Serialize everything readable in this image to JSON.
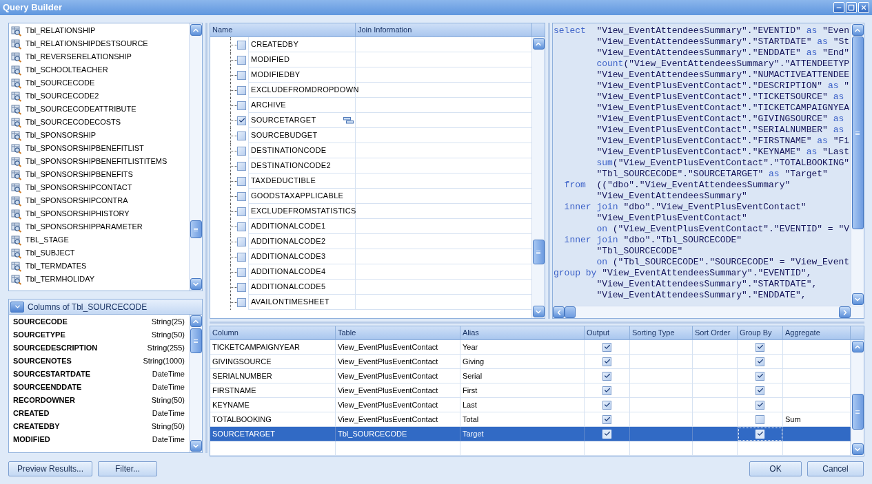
{
  "window": {
    "title": "Query Builder"
  },
  "tables": {
    "items": [
      "Tbl_RELATIONSHIP",
      "Tbl_RELATIONSHIPDESTSOURCE",
      "Tbl_REVERSERELATIONSHIP",
      "Tbl_SCHOOLTEACHER",
      "Tbl_SOURCECODE",
      "Tbl_SOURCECODE2",
      "Tbl_SOURCECODEATTRIBUTE",
      "Tbl_SOURCECODECOSTS",
      "Tbl_SPONSORSHIP",
      "Tbl_SPONSORSHIPBENEFITLIST",
      "Tbl_SPONSORSHIPBENEFITLISTITEMS",
      "Tbl_SPONSORSHIPBENEFITS",
      "Tbl_SPONSORSHIPCONTACT",
      "Tbl_SPONSORSHIPCONTRA",
      "Tbl_SPONSORSHIPHISTORY",
      "Tbl_SPONSORSHIPPARAMETER",
      "TBL_STAGE",
      "Tbl_SUBJECT",
      "Tbl_TERMDATES",
      "Tbl_TERMHOLIDAY"
    ]
  },
  "columns_panel": {
    "title": "Columns of Tbl_SOURCECODE",
    "columns": [
      {
        "name": "SOURCECODE",
        "type": "String(25)"
      },
      {
        "name": "SOURCETYPE",
        "type": "String(50)"
      },
      {
        "name": "SOURCEDESCRIPTION",
        "type": "String(255)"
      },
      {
        "name": "SOURCENOTES",
        "type": "String(1000)"
      },
      {
        "name": "SOURCESTARTDATE",
        "type": "DateTime"
      },
      {
        "name": "SOURCEENDDATE",
        "type": "DateTime"
      },
      {
        "name": "RECORDOWNER",
        "type": "String(50)"
      },
      {
        "name": "CREATED",
        "type": "DateTime"
      },
      {
        "name": "CREATEDBY",
        "type": "String(50)"
      },
      {
        "name": "MODIFIED",
        "type": "DateTime"
      }
    ]
  },
  "tree": {
    "columns": [
      "Name",
      "Join Information"
    ],
    "rows": [
      {
        "name": "CREATEDBY",
        "checked": false
      },
      {
        "name": "MODIFIED",
        "checked": false
      },
      {
        "name": "MODIFIEDBY",
        "checked": false
      },
      {
        "name": "EXCLUDEFROMDROPDOWN",
        "checked": false
      },
      {
        "name": "ARCHIVE",
        "checked": false
      },
      {
        "name": "SOURCETARGET",
        "checked": true
      },
      {
        "name": "SOURCEBUDGET",
        "checked": false
      },
      {
        "name": "DESTINATIONCODE",
        "checked": false
      },
      {
        "name": "DESTINATIONCODE2",
        "checked": false
      },
      {
        "name": "TAXDEDUCTIBLE",
        "checked": false
      },
      {
        "name": "GOODSTAXAPPLICABLE",
        "checked": false
      },
      {
        "name": "EXCLUDEFROMSTATISTICS",
        "checked": false
      },
      {
        "name": "ADDITIONALCODE1",
        "checked": false
      },
      {
        "name": "ADDITIONALCODE2",
        "checked": false
      },
      {
        "name": "ADDITIONALCODE3",
        "checked": false
      },
      {
        "name": "ADDITIONALCODE4",
        "checked": false
      },
      {
        "name": "ADDITIONALCODE5",
        "checked": false
      },
      {
        "name": "AVAILONTIMESHEET",
        "checked": false
      }
    ]
  },
  "sql": {
    "lines": [
      {
        "tokens": [
          {
            "kind": "keyword",
            "text": "select"
          },
          {
            "kind": "text",
            "text": "  \"View_EventAttendeesSummary\".\"EVENTID\" "
          },
          {
            "kind": "keyword",
            "text": "as"
          },
          {
            "kind": "text",
            "text": " \"Even"
          }
        ]
      },
      {
        "tokens": [
          {
            "kind": "text",
            "text": "        \"View_EventAttendeesSummary\".\"STARTDATE\" "
          },
          {
            "kind": "keyword",
            "text": "as"
          },
          {
            "kind": "text",
            "text": " \"St"
          }
        ]
      },
      {
        "tokens": [
          {
            "kind": "text",
            "text": "        \"View_EventAttendeesSummary\".\"ENDDATE\" "
          },
          {
            "kind": "keyword",
            "text": "as"
          },
          {
            "kind": "text",
            "text": " \"End\""
          }
        ]
      },
      {
        "tokens": [
          {
            "kind": "keyword",
            "text": "        count"
          },
          {
            "kind": "text",
            "text": "(\"View_EventAttendeesSummary\".\"ATTENDEETYP"
          }
        ]
      },
      {
        "tokens": [
          {
            "kind": "text",
            "text": "        \"View_EventAttendeesSummary\".\"NUMACTIVEATTENDEE"
          }
        ]
      },
      {
        "tokens": [
          {
            "kind": "text",
            "text": "        \"View_EventPlusEventContact\".\"DESCRIPTION\" "
          },
          {
            "kind": "keyword",
            "text": "as"
          },
          {
            "kind": "text",
            "text": " \""
          }
        ]
      },
      {
        "tokens": [
          {
            "kind": "text",
            "text": "        \"View_EventPlusEventContact\".\"TICKETSOURCE\" "
          },
          {
            "kind": "keyword",
            "text": "as"
          }
        ]
      },
      {
        "tokens": [
          {
            "kind": "text",
            "text": "        \"View_EventPlusEventContact\".\"TICKETCAMPAIGNYEA"
          }
        ]
      },
      {
        "tokens": [
          {
            "kind": "text",
            "text": "        \"View_EventPlusEventContact\".\"GIVINGSOURCE\" "
          },
          {
            "kind": "keyword",
            "text": "as"
          }
        ]
      },
      {
        "tokens": [
          {
            "kind": "text",
            "text": "        \"View_EventPlusEventContact\".\"SERIALNUMBER\" "
          },
          {
            "kind": "keyword",
            "text": "as"
          }
        ]
      },
      {
        "tokens": [
          {
            "kind": "text",
            "text": "        \"View_EventPlusEventContact\".\"FIRSTNAME\" "
          },
          {
            "kind": "keyword",
            "text": "as"
          },
          {
            "kind": "text",
            "text": " \"Fi"
          }
        ]
      },
      {
        "tokens": [
          {
            "kind": "text",
            "text": "        \"View_EventPlusEventContact\".\"KEYNAME\" "
          },
          {
            "kind": "keyword",
            "text": "as"
          },
          {
            "kind": "text",
            "text": " \"Last"
          }
        ]
      },
      {
        "tokens": [
          {
            "kind": "keyword",
            "text": "        sum"
          },
          {
            "kind": "text",
            "text": "(\"View_EventPlusEventContact\".\"TOTALBOOKING\""
          }
        ]
      },
      {
        "tokens": [
          {
            "kind": "text",
            "text": "        \"Tbl_SOURCECODE\".\"SOURCETARGET\" "
          },
          {
            "kind": "keyword",
            "text": "as"
          },
          {
            "kind": "text",
            "text": " \"Target\""
          }
        ]
      },
      {
        "tokens": [
          {
            "kind": "keyword",
            "text": "  from"
          },
          {
            "kind": "text",
            "text": "  ((\"dbo\".\"View_EventAttendeesSummary\""
          }
        ]
      },
      {
        "tokens": [
          {
            "kind": "text",
            "text": "        \"View_EventAttendeesSummary\""
          }
        ]
      },
      {
        "tokens": [
          {
            "kind": "keyword",
            "text": "  inner join"
          },
          {
            "kind": "text",
            "text": " \"dbo\".\"View_EventPlusEventContact\""
          }
        ]
      },
      {
        "tokens": [
          {
            "kind": "text",
            "text": "        \"View_EventPlusEventContact\""
          }
        ]
      },
      {
        "tokens": [
          {
            "kind": "keyword",
            "text": "        on"
          },
          {
            "kind": "text",
            "text": " (\"View_EventPlusEventContact\".\"EVENTID\" = \"V"
          }
        ]
      },
      {
        "tokens": [
          {
            "kind": "keyword",
            "text": "  inner join"
          },
          {
            "kind": "text",
            "text": " \"dbo\".\"Tbl_SOURCECODE\""
          }
        ]
      },
      {
        "tokens": [
          {
            "kind": "text",
            "text": "        \"Tbl_SOURCECODE\""
          }
        ]
      },
      {
        "tokens": [
          {
            "kind": "keyword",
            "text": "        on"
          },
          {
            "kind": "text",
            "text": " (\"Tbl_SOURCECODE\".\"SOURCECODE\" = \"View_Event"
          }
        ]
      },
      {
        "tokens": [
          {
            "kind": "keyword",
            "text": "group by"
          },
          {
            "kind": "text",
            "text": " \"View_EventAttendeesSummary\".\"EVENTID\","
          }
        ]
      },
      {
        "tokens": [
          {
            "kind": "text",
            "text": "        \"View_EventAttendeesSummary\".\"STARTDATE\","
          }
        ]
      },
      {
        "tokens": [
          {
            "kind": "text",
            "text": "        \"View_EventAttendeesSummary\".\"ENDDATE\","
          }
        ]
      }
    ]
  },
  "grid": {
    "columns": [
      "Column",
      "Table",
      "Alias",
      "Output",
      "Sorting Type",
      "Sort Order",
      "Group By",
      "Aggregate"
    ],
    "rows": [
      {
        "column": "TICKETCAMPAIGNYEAR",
        "table": "View_EventPlusEventContact",
        "alias": "Year",
        "output": true,
        "group_by": true,
        "selected": false
      },
      {
        "column": "GIVINGSOURCE",
        "table": "View_EventPlusEventContact",
        "alias": "Giving",
        "output": true,
        "group_by": true,
        "selected": false
      },
      {
        "column": "SERIALNUMBER",
        "table": "View_EventPlusEventContact",
        "alias": "Serial",
        "output": true,
        "group_by": true,
        "selected": false
      },
      {
        "column": "FIRSTNAME",
        "table": "View_EventPlusEventContact",
        "alias": "First",
        "output": true,
        "group_by": true,
        "selected": false
      },
      {
        "column": "KEYNAME",
        "table": "View_EventPlusEventContact",
        "alias": "Last",
        "output": true,
        "group_by": true,
        "selected": false
      },
      {
        "column": "TOTALBOOKING",
        "table": "View_EventPlusEventContact",
        "alias": "Total",
        "output": true,
        "group_by": false,
        "aggregate": "Sum",
        "selected": false
      },
      {
        "column": "SOURCETARGET",
        "table": "Tbl_SOURCECODE",
        "alias": "Target",
        "output": true,
        "group_by": true,
        "selected": true
      }
    ]
  },
  "buttons": {
    "left": [
      "Preview Results...",
      "Filter..."
    ],
    "right": [
      "OK",
      "Cancel"
    ]
  }
}
